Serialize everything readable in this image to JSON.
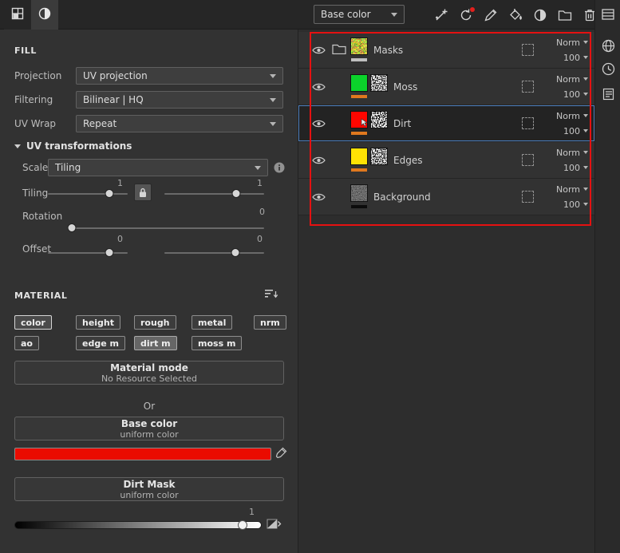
{
  "topbar": {
    "channel_filter": {
      "value": "Base color"
    },
    "tool_icons": [
      "polygon-fill-tool",
      "projection-tool",
      "paint-tool",
      "fill-bucket-tool",
      "smudge-tool",
      "add-folder",
      "delete-layer"
    ]
  },
  "right_dock_icons": [
    "panels-icon",
    "globe-icon",
    "history-icon",
    "notes-icon"
  ],
  "left_panel": {
    "fill": {
      "title": "FILL",
      "projection": {
        "label": "Projection",
        "value": "UV projection"
      },
      "filtering": {
        "label": "Filtering",
        "value": "Bilinear | HQ"
      },
      "uv_wrap": {
        "label": "UV Wrap",
        "value": "Repeat"
      },
      "uv_transformations": {
        "title": "UV transformations",
        "scale": {
          "label": "Scale",
          "value": "Tiling"
        },
        "tiling": {
          "label": "Tiling",
          "value_left": "1",
          "value_right": "1"
        },
        "rotation": {
          "label": "Rotation",
          "value": "0"
        },
        "offset": {
          "label": "Offset",
          "value_left": "0",
          "value_right": "0"
        }
      }
    },
    "material": {
      "title": "MATERIAL",
      "channels": [
        "color",
        "height",
        "rough",
        "metal",
        "nrm",
        "ao",
        "edge m",
        "dirt m",
        "moss m"
      ],
      "material_mode": {
        "title": "Material mode",
        "subtitle": "No Resource Selected"
      },
      "or_label": "Or",
      "base_color": {
        "title": "Base color",
        "subtitle": "uniform color",
        "swatch_color": "#ea0b00"
      },
      "dirt_mask": {
        "title": "Dirt Mask",
        "subtitle": "uniform color",
        "value": "1"
      }
    }
  },
  "layers_panel": {
    "layers": [
      {
        "name": "Masks",
        "blend": "Norm",
        "opacity": "100",
        "type": "folder"
      },
      {
        "name": "Moss",
        "blend": "Norm",
        "opacity": "100",
        "color": "#0bd32b"
      },
      {
        "name": "Dirt",
        "blend": "Norm",
        "opacity": "100",
        "color": "#ff0600",
        "selected": true
      },
      {
        "name": "Edges",
        "blend": "Norm",
        "opacity": "100",
        "color": "#ffe204"
      },
      {
        "name": "Background",
        "blend": "Norm",
        "opacity": "100"
      }
    ]
  },
  "colors": {
    "annotation": "#e51111",
    "selection_border": "#4d7fbe",
    "channel_bar": "#e0781e"
  }
}
